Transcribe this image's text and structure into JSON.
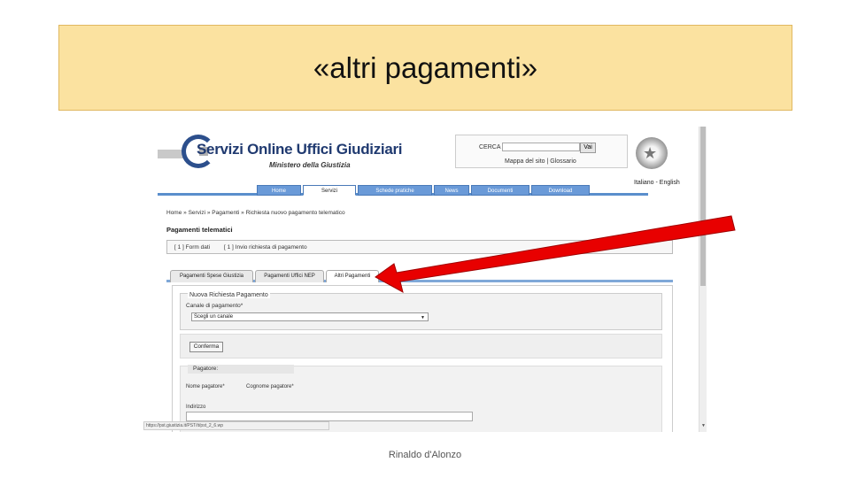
{
  "slide": {
    "title": "«altri pagamenti»",
    "footer": "Rinaldo d'Alonzo"
  },
  "site": {
    "logo_text": "Servizi Online Uffici Giudiziari",
    "ministry": "Ministero della Giustizia",
    "search_label": "CERCA",
    "search_button": "Vai",
    "sitemap_links": "Mappa del sito | Glossario",
    "language_links": "Italiano - English"
  },
  "nav": {
    "tabs": [
      "Home",
      "Servizi",
      "Schede pratiche",
      "News",
      "Documenti",
      "Download"
    ],
    "active_index": 1
  },
  "page": {
    "breadcrumb": "Home » Servizi » Pagamenti » Richiesta nuovo pagamento telematico",
    "heading": "Pagamenti telematici",
    "steps": [
      "[ 1 ] Form dati",
      "[ 1 ] Invio richiesta di pagamento"
    ]
  },
  "payment_tabs": {
    "tabs": [
      "Pagamenti Spese Giustizia",
      "Pagamenti Uffici NEP",
      "Altri Pagamenti"
    ],
    "active_index": 2
  },
  "form": {
    "legend": "Nuova Richiesta Pagamento",
    "canale_label": "Canale di pagamento*",
    "canale_value": "Scegli un canale",
    "confirm_button": "Conferma",
    "pagatore_title": "Pagatore:",
    "nome_label": "Nome pagatore*",
    "cognome_label": "Cognome pagatore*",
    "indirizzo_label": "Indirizzo"
  },
  "statusbar": {
    "url": "https://pst.giustizia.it/PST/it/pst_2_6.wp"
  },
  "colors": {
    "banner": "#fbe2a0",
    "arrow": "#e80000",
    "nav_tab": "#6a9ad8"
  }
}
